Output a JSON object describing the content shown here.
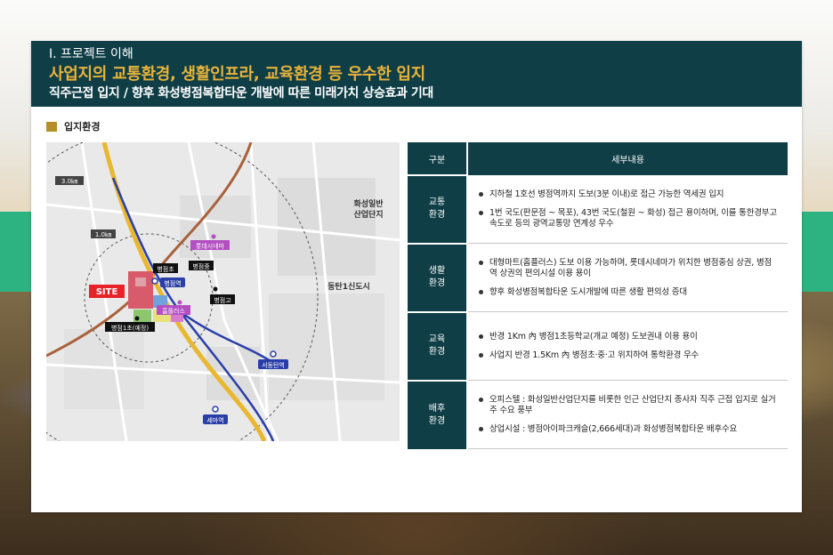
{
  "header": {
    "section": "Ⅰ. 프로젝트 이해",
    "title": "사업지의 교통환경, 생활인프라, 교육환경 등 우수한 입지",
    "subtitle": "직주근접 입지 / 향후 화성병점복합타운 개발에 따른 미래가치 상승효과 기대"
  },
  "section_label": "입지환경",
  "map": {
    "radius_outer": "3.0㎞",
    "radius_inner": "1.0㎞",
    "site": "SITE",
    "labels": {
      "byeongjeom_el": "병점초",
      "byeongjeom_mid": "병점중",
      "byeongjeom_high": "병점고",
      "byeongjeom_1_el": "병점1초(예정)",
      "lotte_cinema": "롯데시네마",
      "homeplus": "홈플러스",
      "byeongjeom_station": "병점역",
      "seodongtan_station": "서동탄역",
      "sema_station": "세마역",
      "hwaseong_industrial": "화성일반\n산업단지",
      "dongtan_new_town": "동탄1신도시"
    }
  },
  "table": {
    "headers": [
      "구분",
      "세부내용"
    ],
    "rows": [
      {
        "category": "교통\n환경",
        "items": [
          "지하철 1호선 병점역까지 도보(3분 이내)로 접근 가능한 역세권 입지",
          "1번 국도(판문점 ~ 목포), 43번 국도(철원 ~ 화성) 접근 용이하며, 이를 통한경부고속도로 등의 광역교통망 연계성 우수"
        ]
      },
      {
        "category": "생활\n환경",
        "items": [
          "대형마트(홈플러스) 도보 이용 가능하며, 롯데시네마가 위치한 병점중심 상권, 병점역 상권의 편의시설 이용 용이",
          "향후 화성병점복합타운 도시개발에 따른 생활 편의성 증대"
        ]
      },
      {
        "category": "교육\n환경",
        "items": [
          "반경 1Km 內 병점1초등학교(개교 예정) 도보권내 이용 용이",
          "사업지 반경 1.5Km 內 병점초·중·고 위치하여 통학환경 우수"
        ]
      },
      {
        "category": "배후\n환경",
        "items": [
          "오피스텔 : 화성일반산업단지를 비롯한 인근 산업단지 종사자 직주 근접 입지로 실거주 수요 풍부",
          "상업시설 : 병점아이파크캐슬(2,666세대)과 화성병점복합타운 배후수요"
        ]
      }
    ]
  },
  "colors": {
    "header_bg": "#0f3e47",
    "title_gold": "#e8b339",
    "section_bullet": "#b58d2a",
    "site_red": "#e8222a",
    "subway_blue": "#2a3ea8",
    "rail_yellow": "#e8b830"
  }
}
